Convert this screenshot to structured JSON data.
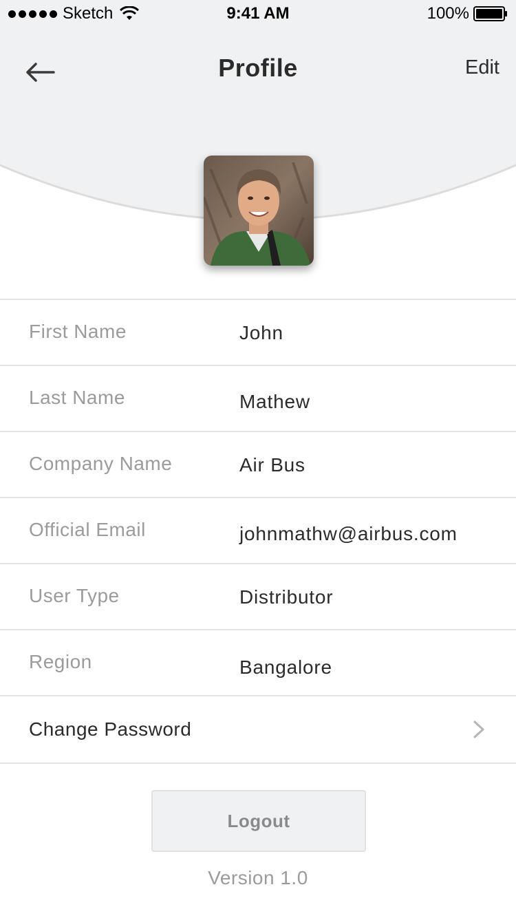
{
  "status_bar": {
    "carrier": "Sketch",
    "time": "9:41 AM",
    "battery": "100%"
  },
  "nav": {
    "title": "Profile",
    "edit_label": "Edit",
    "back_icon": "arrow-left-icon"
  },
  "profile": {
    "avatar_icon": "user-photo"
  },
  "fields": [
    {
      "label": "First Name",
      "value": "John"
    },
    {
      "label": "Last Name",
      "value": "Mathew"
    },
    {
      "label": "Company Name",
      "value": "Air Bus"
    },
    {
      "label": "Official Email",
      "value": "johnmathw@airbus.com"
    },
    {
      "label": "User Type",
      "value": "Distributor"
    },
    {
      "label": "Region",
      "value": "Bangalore"
    }
  ],
  "change_password": {
    "label": "Change Password",
    "icon": "chevron-right-icon"
  },
  "logout_label": "Logout",
  "version": "Version 1.0",
  "colors": {
    "header_bg": "#f0f1f2",
    "label": "#9b9b9b",
    "value": "#2b2b2b",
    "divider": "#e3e3e3"
  }
}
